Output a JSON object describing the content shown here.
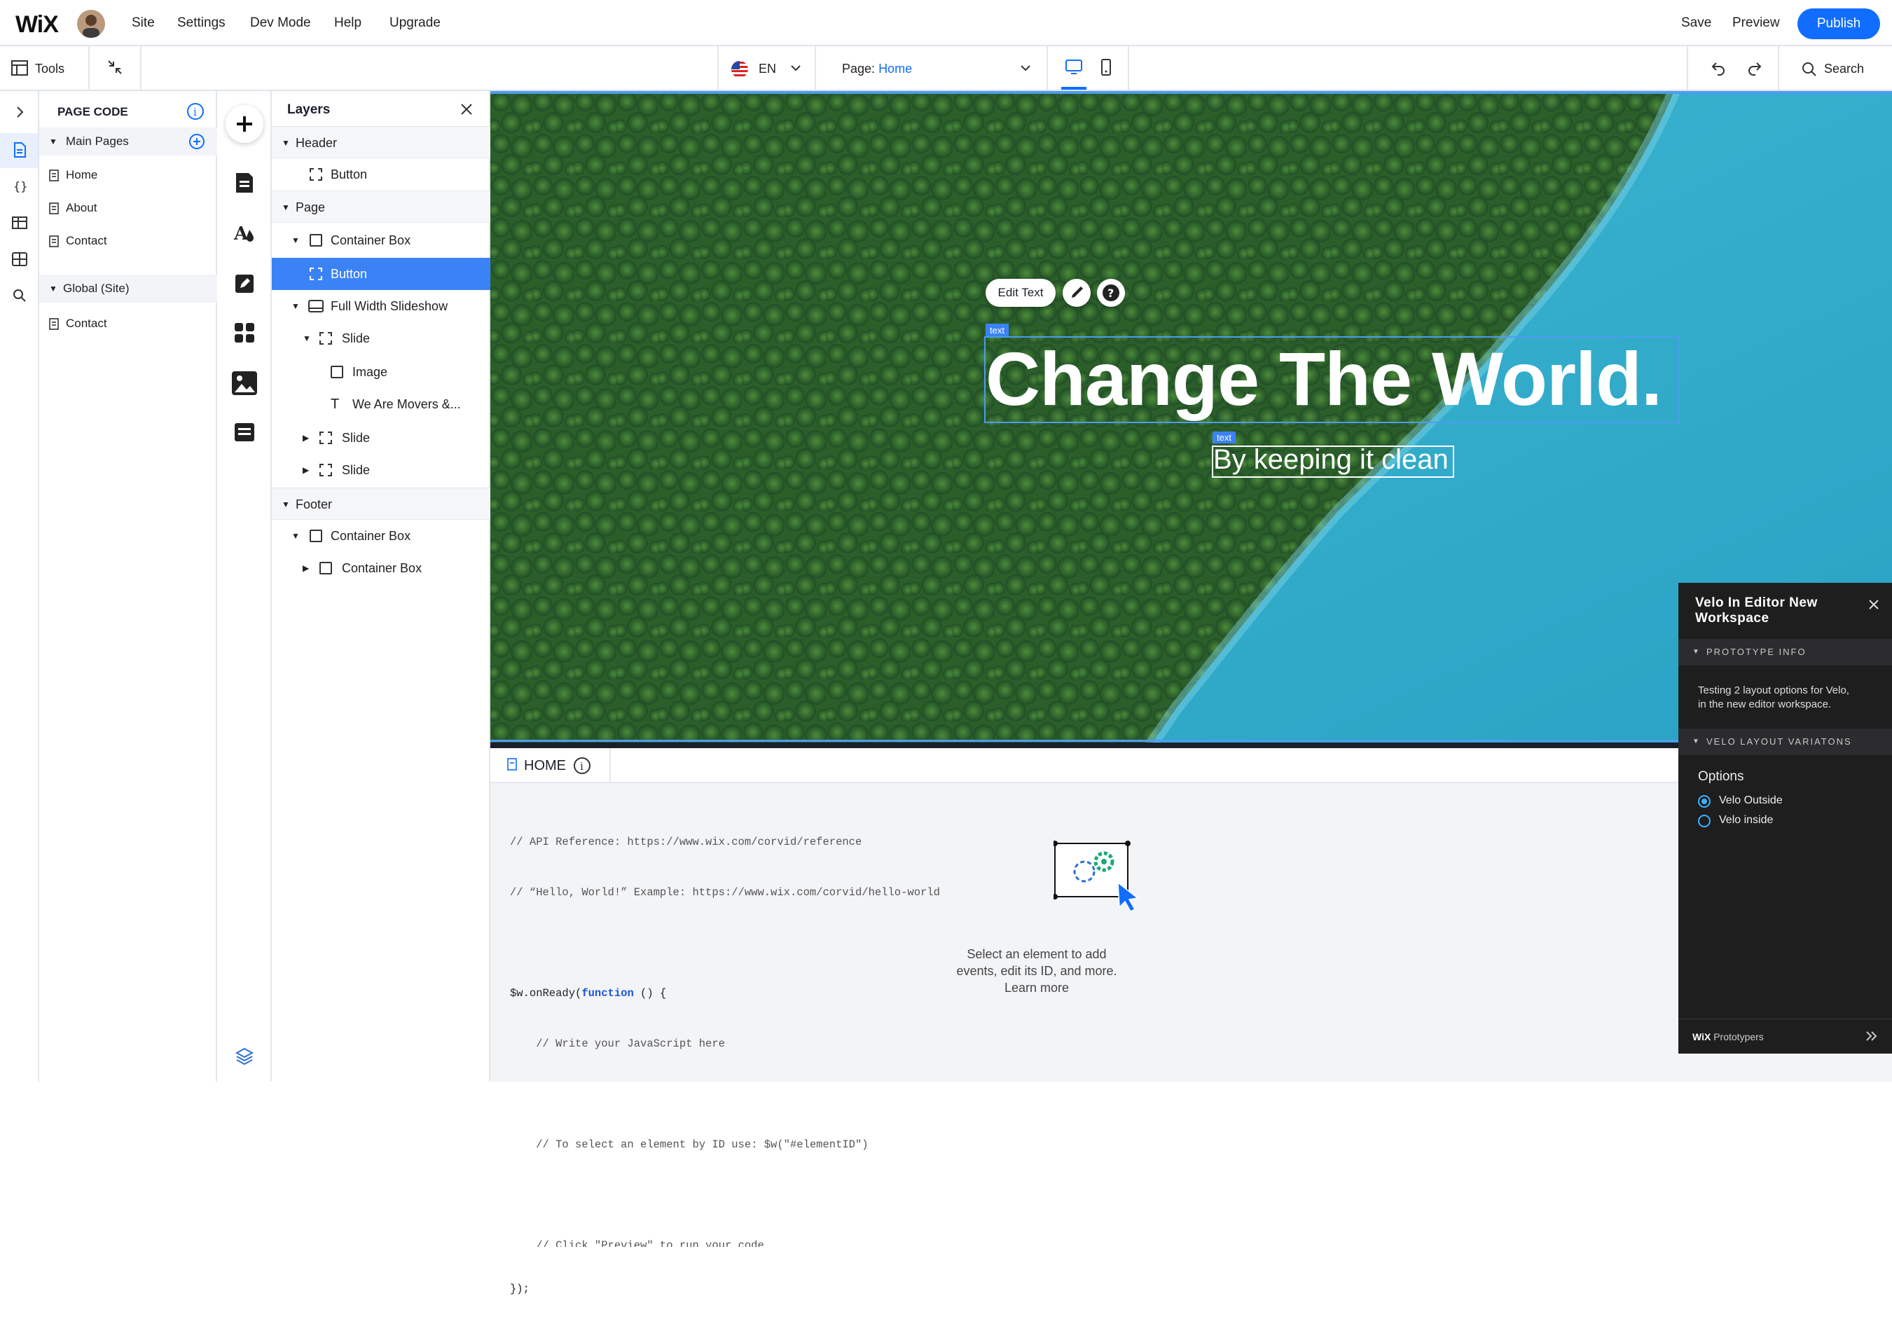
{
  "app": {
    "logo": "WiX"
  },
  "topbar": {
    "menu": [
      "Site",
      "Settings",
      "Dev Mode",
      "Help",
      "Upgrade"
    ],
    "save": "Save",
    "preview": "Preview",
    "publish": "Publish"
  },
  "toolbar": {
    "tools": "Tools",
    "language": "EN",
    "page_label": "Page:",
    "page_value": "Home",
    "search": "Search"
  },
  "page_code": {
    "title": "PAGE CODE",
    "main_pages_label": "Main Pages",
    "main_pages": [
      "Home",
      "About",
      "Contact"
    ],
    "global_label": "Global (Site)",
    "global_items": [
      "Contact"
    ]
  },
  "layers": {
    "title": "Layers",
    "header": "Header",
    "header_button": "Button",
    "page": "Page",
    "container_box": "Container Box",
    "button_selected": "Button",
    "slideshow": "Full Width Slideshow",
    "slide1": "Slide",
    "image": "Image",
    "text_item": "We Are Movers &...",
    "slide2": "Slide",
    "slide3": "Slide",
    "footer": "Footer",
    "footer_container1": "Container Box",
    "footer_container2": "Container Box"
  },
  "canvas": {
    "edit_text": "Edit Text",
    "text_tag1": "text",
    "text_tag2": "text",
    "hero_title": "Change The World.",
    "hero_subtitle": "By keeping it clean"
  },
  "code": {
    "tab": "HOME",
    "lines": [
      "// API Reference: https://www.wix.com/corvid/reference",
      "// “Hello, World!” Example: https://www.wix.com/corvid/hello-world",
      "",
      "$w.onReady(function () {",
      "    // Write your JavaScript here",
      "",
      "    // To select an element by ID use: $w(\"#elementID\")",
      "",
      "    // Click \"Preview\" to run your code",
      "});"
    ],
    "hint_line1": "Select an element to add",
    "hint_line2": "events, edit its ID, and more.",
    "hint_link": "Learn more"
  },
  "velo": {
    "title_line1": "Velo In Editor New",
    "title_line2": "Workspace",
    "section1": "PROTOTYPE INFO",
    "info_line1": "Testing 2 layout options for Velo,",
    "info_line2": "in the new editor workspace.",
    "section2": "VELO LAYOUT VARIATONS",
    "options_label": "Options",
    "option1": "Velo Outside",
    "option2": "Velo inside",
    "footer_brand": "WiX",
    "footer_text": "Prototypers"
  },
  "colors": {
    "accent": "#116dff",
    "selection": "#3b82f6",
    "panel_dark": "#1e1e1f"
  }
}
